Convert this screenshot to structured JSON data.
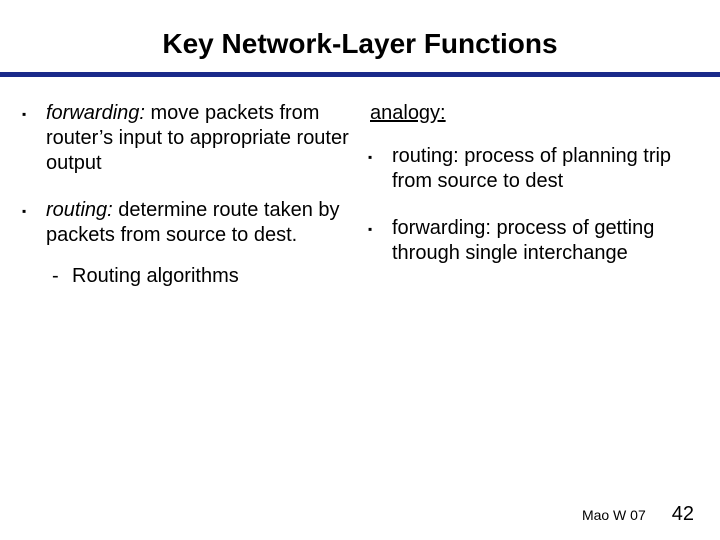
{
  "title": "Key Network-Layer Functions",
  "left": {
    "items": [
      {
        "term": "forwarding:",
        "rest": " move packets from router’s input to appropriate router output"
      },
      {
        "term": "routing:",
        "rest": " determine route taken by packets from source to dest."
      }
    ],
    "sub": "Routing algorithms"
  },
  "right": {
    "label": "analogy:",
    "items": [
      "routing: process of planning trip from source to dest",
      "forwarding: process of getting through single interchange"
    ]
  },
  "footer": {
    "credit": "Mao W 07",
    "page": "42"
  }
}
